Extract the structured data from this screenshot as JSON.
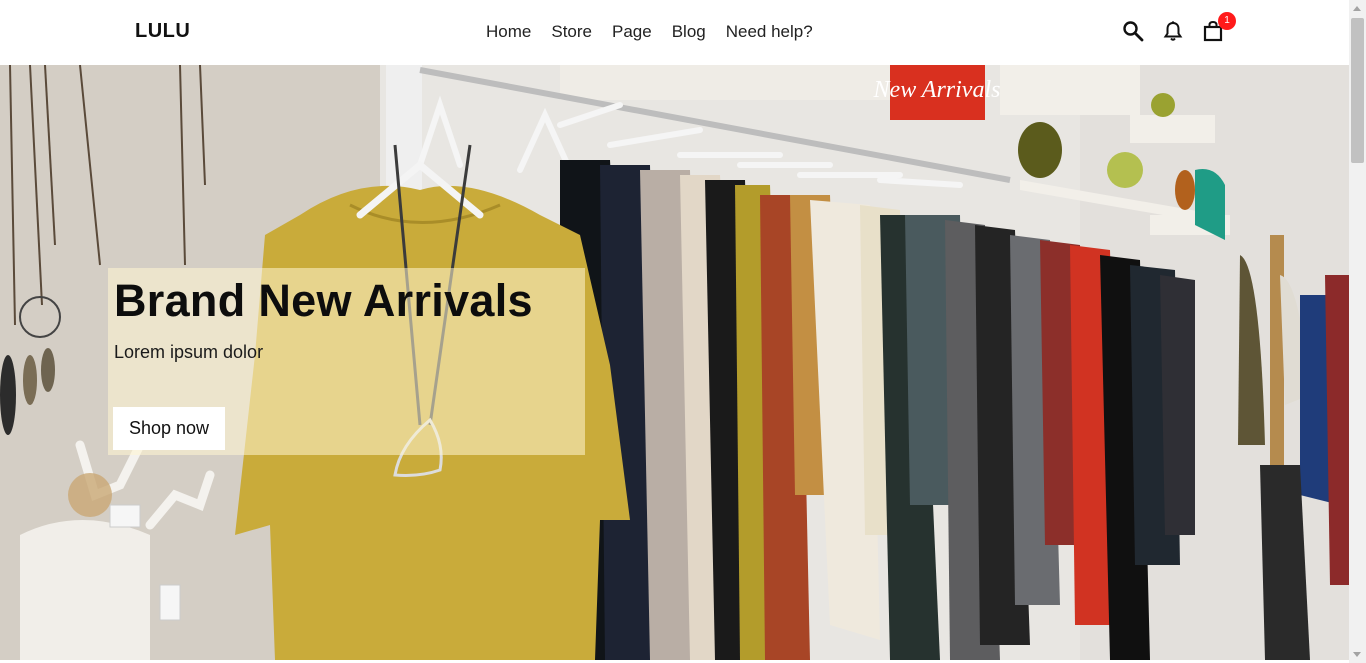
{
  "header": {
    "logo": "LULU",
    "nav": [
      "Home",
      "Store",
      "Page",
      "Blog",
      "Need help?"
    ],
    "icons": [
      "search-icon",
      "bell-icon",
      "shopping-bag-icon"
    ],
    "cart_count": "1"
  },
  "hero": {
    "title": "Brand New Arrivals",
    "subtitle": "Lorem ipsum dolor",
    "button_label": "Shop now",
    "sign_text": "New Arrivals"
  },
  "colors": {
    "badge": "#ff1a1a",
    "card_overlay": "rgba(255,245,210,0.55)",
    "mustard": "#c8a83a"
  }
}
